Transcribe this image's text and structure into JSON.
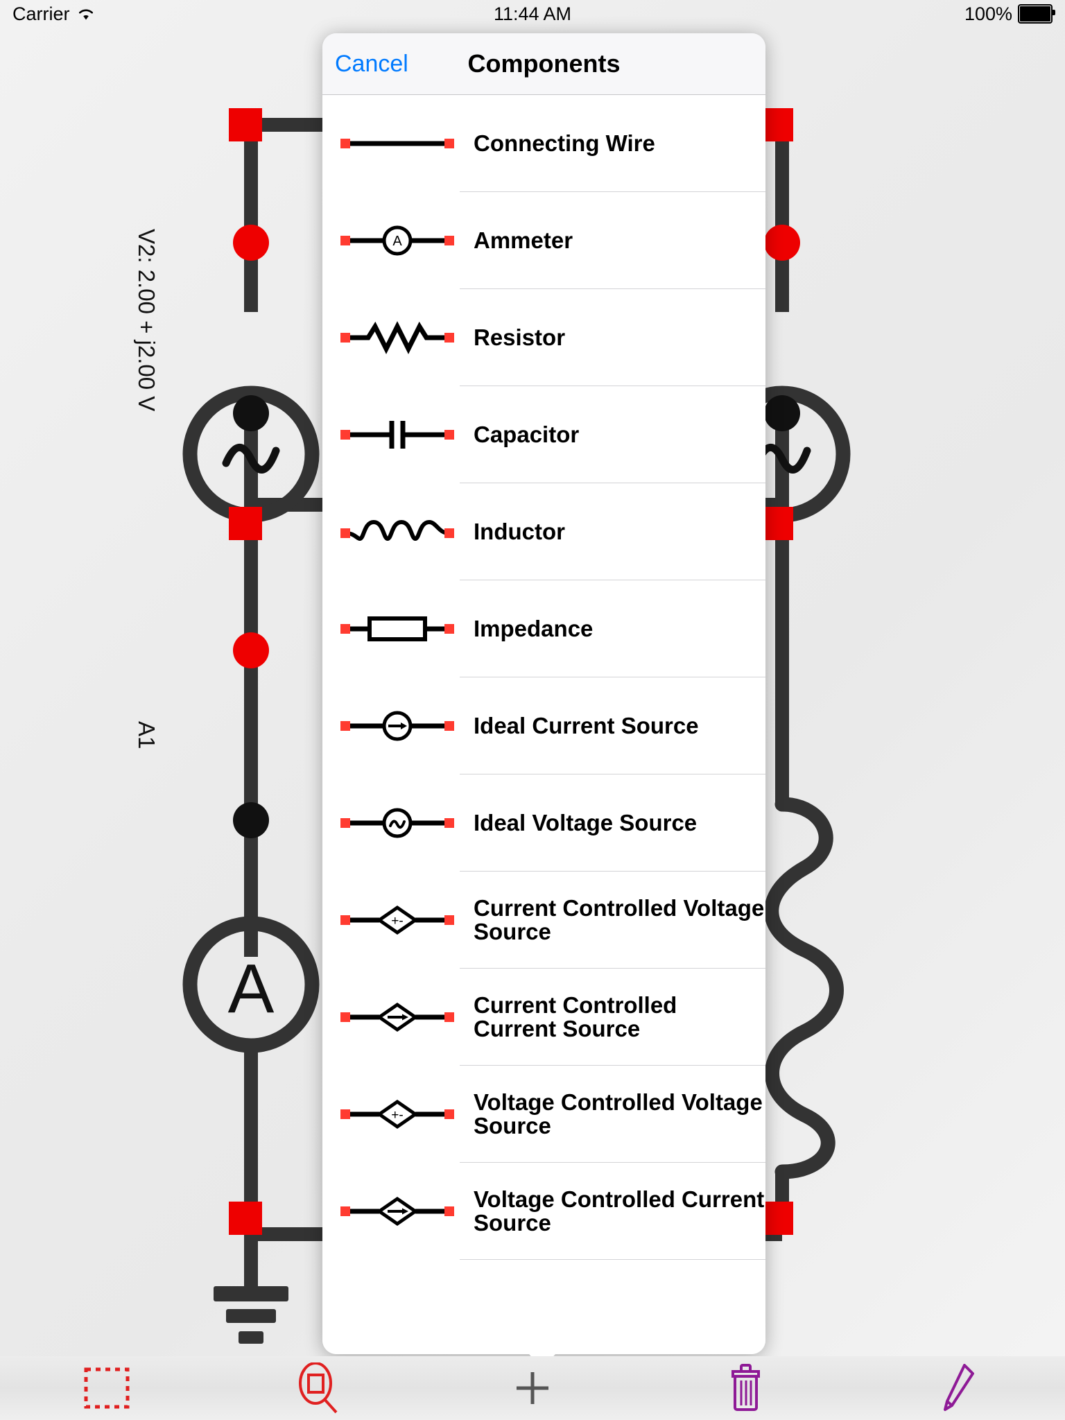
{
  "status_bar": {
    "carrier": "Carrier",
    "wifi_icon": "wifi-icon",
    "time": "11:44 AM",
    "battery_percent": "100%",
    "battery_icon": "battery-full-icon"
  },
  "popover": {
    "cancel_label": "Cancel",
    "title": "Components",
    "items": [
      {
        "label": "Connecting Wire",
        "symbol": "wire-symbol"
      },
      {
        "label": "Ammeter",
        "symbol": "ammeter-symbol"
      },
      {
        "label": "Resistor",
        "symbol": "resistor-symbol"
      },
      {
        "label": "Capacitor",
        "symbol": "capacitor-symbol"
      },
      {
        "label": "Inductor",
        "symbol": "inductor-symbol"
      },
      {
        "label": "Impedance",
        "symbol": "impedance-symbol"
      },
      {
        "label": "Ideal Current Source",
        "symbol": "ideal-current-source-symbol"
      },
      {
        "label": "Ideal Voltage Source",
        "symbol": "ideal-voltage-source-symbol"
      },
      {
        "label": "Current Controlled Voltage Source",
        "symbol": "ccvs-symbol"
      },
      {
        "label": "Current Controlled Current Source",
        "symbol": "cccs-symbol"
      },
      {
        "label": "Voltage Controlled Voltage Source",
        "symbol": "vcvs-symbol"
      },
      {
        "label": "Voltage Controlled Current Source",
        "symbol": "vccs-symbol"
      }
    ]
  },
  "circuit": {
    "labels": [
      {
        "text": "V2: 2.00 + j2.00 V",
        "name": "voltage-source-v2-label"
      },
      {
        "text": "A1",
        "name": "ammeter-a1-label"
      }
    ],
    "elements": [
      "voltage-source-left",
      "ammeter-left",
      "ground-symbol",
      "voltage-source-right",
      "inductor-right"
    ]
  },
  "toolbar": {
    "buttons": [
      {
        "name": "select-region-tool",
        "icon": "dashed-rectangle-icon",
        "color": "#e02020"
      },
      {
        "name": "zoom-tool",
        "icon": "magnifier-rectangle-icon",
        "color": "#e02020"
      },
      {
        "name": "add-component-button",
        "icon": "plus-icon",
        "color": "#555555"
      },
      {
        "name": "delete-button",
        "icon": "trash-icon",
        "color": "#8e1a96"
      },
      {
        "name": "edit-button",
        "icon": "pencil-icon",
        "color": "#8e1a96"
      }
    ]
  },
  "colors": {
    "accent_blue": "#007aff",
    "node_red": "#ee0000",
    "wire_dark": "#333333",
    "purple": "#8e1a96"
  }
}
